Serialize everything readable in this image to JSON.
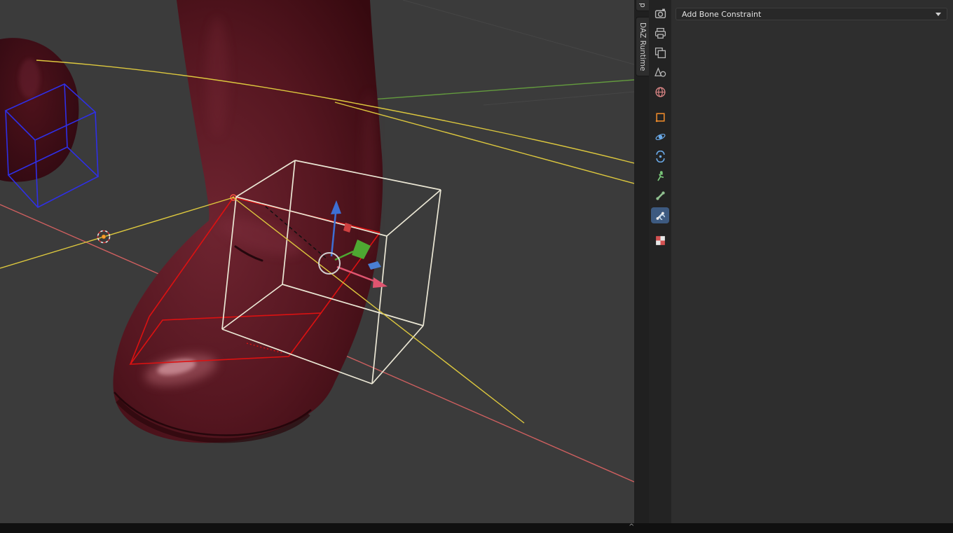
{
  "viewport": {
    "collapse_chevron": "^",
    "colors": {
      "background": "#3b3b3b",
      "active_bone_wire": "#ebe7d5",
      "selected_bone_wire": "#dd1111",
      "unselected_bone_wire": "#2f2fe6",
      "bone_relationship_line": "#ddc83e",
      "floor_axis_red": "#cd5f5f",
      "floor_axis_green": "#639a3e",
      "gizmo_x_axis": "#e05570",
      "gizmo_y_axis": "#4ea832",
      "gizmo_z_axis": "#3d6fd4",
      "mesh_surface": "#551620",
      "cursor_origin_dot": "#ff9d2e"
    }
  },
  "viewport_sidebar": {
    "partial_tab_label": "p",
    "tabs": [
      {
        "label": "DAZ Runtime"
      }
    ]
  },
  "properties_tab_bar": {
    "items": [
      {
        "name": "render-properties",
        "selected": false
      },
      {
        "name": "output-properties",
        "selected": false
      },
      {
        "name": "view-layer-properties",
        "selected": false
      },
      {
        "name": "scene-properties",
        "selected": false
      },
      {
        "name": "world-properties",
        "selected": false
      },
      {
        "name": "object-properties",
        "selected": false
      },
      {
        "name": "physics-properties",
        "selected": false
      },
      {
        "name": "object-constraint-properties",
        "selected": false
      },
      {
        "name": "object-data-properties",
        "selected": false
      },
      {
        "name": "bone-properties",
        "selected": false
      },
      {
        "name": "bone-constraint-properties",
        "selected": true
      },
      {
        "name": "texture-properties",
        "selected": false
      }
    ]
  },
  "properties_panel": {
    "dropdown_label": "Add Bone Constraint"
  }
}
